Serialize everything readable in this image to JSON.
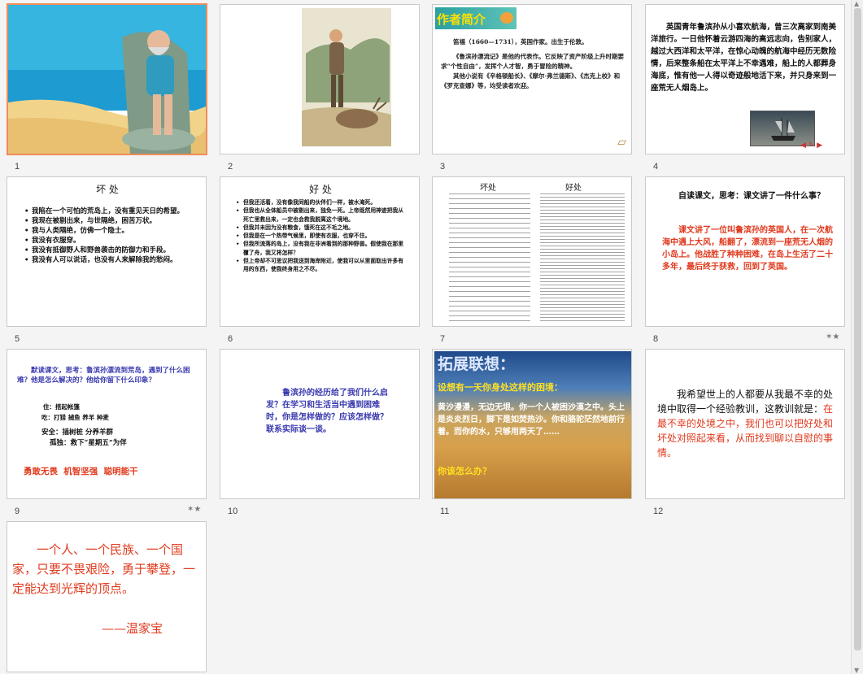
{
  "slides": [
    {
      "num": "1"
    },
    {
      "num": "2"
    },
    {
      "num": "3",
      "heading": "作者简介",
      "paras": [
        "笛福（1660—1731），英国作家。出生于伦敦。",
        "《鲁滨孙漂流记》是他的代表作。它反映了资产阶级上升时期要求“个性自由”，发挥个人才智，勇于冒险的精神。",
        "其他小说有《辛格顿船长》、《摩尔·弗兰德斯》、《杰克上校》和《罗克查娜》等，均受读者欢迎。"
      ]
    },
    {
      "num": "4",
      "text": "英国青年鲁滨孙从小喜欢航海，曾三次离家到南美洋旅行。一日他怀着云游四海的高远志向，告别家人，越过大西洋和太平洋，在惊心动魄的航海中经历无数险情，后来整条船在太平洋上不幸遇难，船上的人都葬身海底，惟有他一人得以奇迹般地活下来，并只身来到一座荒无人烟岛上。"
    },
    {
      "num": "5",
      "title": "坏  处",
      "items": [
        "我陷在一个可怕的荒岛上，没有重见天日的希望。",
        "我现在被剔出来，与世隔绝，困苦万状。",
        "我与人类隔绝，仿佛一个隐士。",
        "我没有衣服穿。",
        "我没有抵御野人和野兽袭击的防御力和手段。",
        "我没有人可以说话，也没有人来解除我的愁闷。"
      ]
    },
    {
      "num": "6",
      "title": "好  处",
      "items": [
        "但我还活着，没有像我同船的伙伴们一样，被水淹死。",
        "但我也从全体船员中被剔出来，独免一死。上帝既然用神迹把我从死亡里救出来，一定也会救我脱离这个境地。",
        "但我并未因为没有粮食，饿死在这不毛之地。",
        "但我是在一个热带气候里，即使有衣服，也穿不住。",
        "但我所流落的岛上，没有我在非洲看到的那种野兽。假使我在那里覆了舟，我又将怎样？",
        "但上帝却不可思议把我送到海岸附近，使我可以从里面取出许多有用的东西，使我终身用之不尽。"
      ]
    },
    {
      "num": "7",
      "col_left": "坏处",
      "col_right": "好处"
    },
    {
      "num": "8",
      "prompt": "自读课文，思考：课文讲了一件什么事？",
      "answer": "课文讲了一位叫鲁滨孙的英国人，在一次航海中遇上大风，船翻了，漂流到一座荒无人烟的小岛上。他战胜了种种困难，在岛上生活了二十多年，最后终于获救，回到了英国。"
    },
    {
      "num": "9",
      "prompt": "默读课文，思考：鲁滨孙漂流到荒岛，遇到了什么困难？他是怎么解决的？他给你留下什么印象？",
      "lines": [
        "住：搭起帐篷",
        "吃：打猎  捕鱼  养羊  种麦",
        "安全：插树桩  分养羊群",
        "孤独：救下“星期五”为伴"
      ],
      "summary": "勇敢无畏  机智坚强  聪明能干"
    },
    {
      "num": "10",
      "text": "鲁滨孙的经历给了我们什么启发？在学习和生活当中遇到困难时，你是怎样做的？应该怎样做？联系实际谈一谈。"
    },
    {
      "num": "11",
      "title": "拓展联想：",
      "subtitle": "设想有一天你身处这样的困境：",
      "body": "黄沙漫漫，无边无垠。你一个人被困沙漠之中。头上是炎炎烈日，脚下是如焚热沙。你和骆驼茫然地前行着。而你的水，只够用两天了……",
      "question": "你该怎么办？"
    },
    {
      "num": "12",
      "text_black": "我希望世上的人都要从我最不幸的处境中取得一个经验教训，这教训就是：",
      "text_red": "在最不幸的处境之中，我们也可以把好处和坏处对照起来看，从而找到聊以自慰的事情。"
    },
    {
      "num": "",
      "quote": "一个人、一个民族、一个国家，只要不畏艰险，勇于攀登，一定能达到光辉的顶点。",
      "author": "——温家宝"
    }
  ],
  "colors": {
    "red": "#e03a1e",
    "blue": "#3a3ab0",
    "selected": "#f08c5a"
  }
}
